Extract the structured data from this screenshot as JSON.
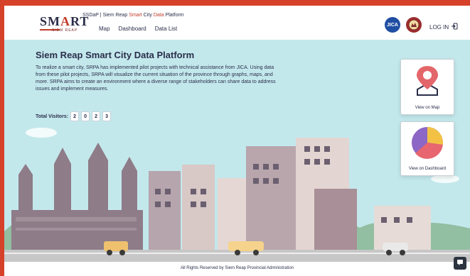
{
  "header": {
    "logo_text_before": "SM",
    "logo_text_a": "A",
    "logo_text_after": "RT",
    "logo_sub": "SIEM REAP",
    "site_title": {
      "abbr": "SSDaP",
      "separator": "|",
      "p1": "Siem Reap",
      "p2": "Smart",
      "p3": "City",
      "p4": "Data",
      "p5": "Platform"
    },
    "nav": [
      {
        "label": "Map"
      },
      {
        "label": "Dashboard"
      },
      {
        "label": "Data List"
      }
    ],
    "partners": [
      {
        "label": "JICA",
        "icon": "jica-logo-icon"
      },
      {
        "label": "",
        "icon": "srpa-emblem-icon"
      }
    ],
    "login_label": "LOG IN"
  },
  "hero": {
    "title": "Siem Reap Smart City Data Platform",
    "description": "To realize a smart city, SRPA has implemented pilot projects with technical assistance from JICA. Using data from these pilot projects, SRPA will visualize the current situation of the province through graphs, maps, and more. SRPA aims to create an environment where a diverse range of stakeholders can share data to address issues and implement measures.",
    "visitors_label": "Total Visitors:",
    "visitors_digits": [
      "2",
      "0",
      "2",
      "3"
    ]
  },
  "cards": [
    {
      "label": "View on Map",
      "icon": "map-pin-icon"
    },
    {
      "label": "View on Dashboard",
      "icon": "pie-chart-icon"
    }
  ],
  "footer": {
    "copyright": "All Rights Reserved by Siem Reap Provincial Administration"
  },
  "colors": {
    "accent": "#d6412a",
    "sky": "#c3e8ec",
    "text": "#2a2e4a"
  }
}
